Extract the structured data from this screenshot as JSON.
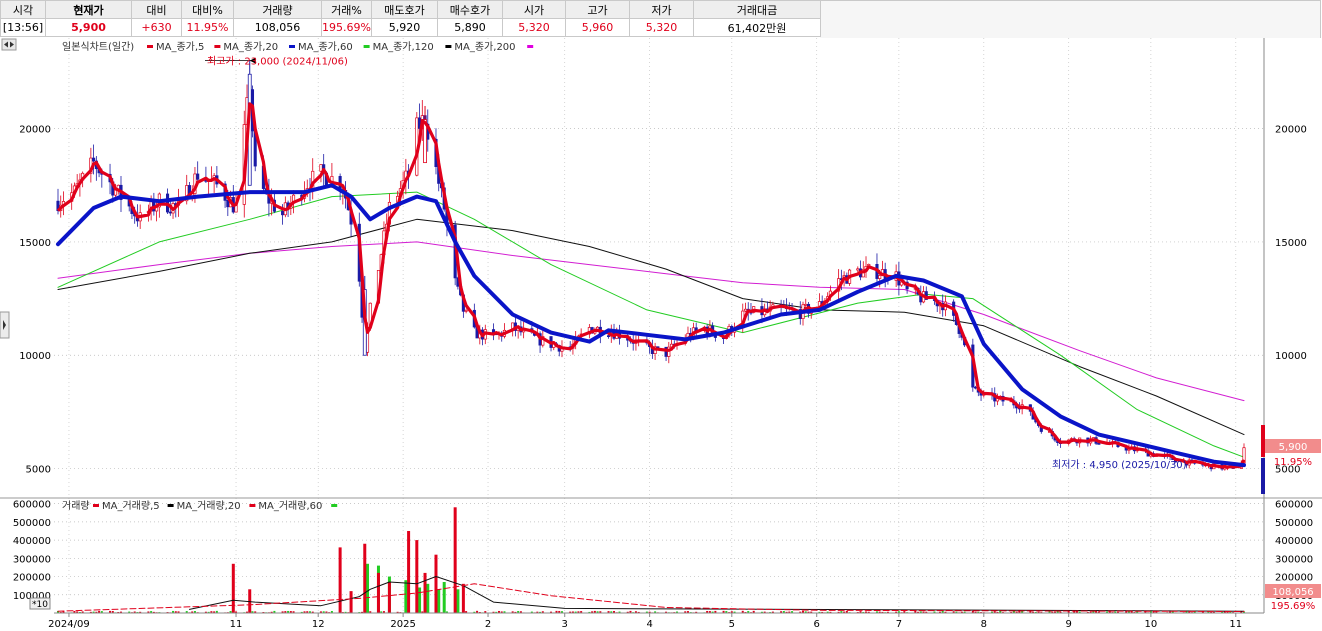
{
  "quote": {
    "headers": [
      "시각",
      "현재가",
      "대비",
      "대비%",
      "거래량",
      "거래%",
      "매도호가",
      "매수호가",
      "시가",
      "고가",
      "저가",
      "거래대금"
    ],
    "values": [
      "[13:56]",
      "5,900",
      "+630",
      "11.95%",
      "108,056",
      "195.69%",
      "5,920",
      "5,890",
      "5,320",
      "5,960",
      "5,320",
      "61,402만원"
    ]
  },
  "price_legend": {
    "title": "일본식차트(일간)",
    "items": [
      {
        "label": "MA_종가,5",
        "color": "#e0001b"
      },
      {
        "label": "MA_종가,20",
        "color": "#e0001b"
      },
      {
        "label": "MA_종가,60",
        "color": "#0a14c8"
      },
      {
        "label": "MA_종가,120",
        "color": "#22cc22"
      },
      {
        "label": "MA_종가,200",
        "color": "#000000"
      }
    ],
    "end_marker_color": "#e000e0"
  },
  "volume_legend": {
    "title": "거래량",
    "items": [
      {
        "label": "MA_거래량,5",
        "color": "#e0001b"
      },
      {
        "label": "MA_거래량,20",
        "color": "#000000"
      },
      {
        "label": "MA_거래량,60",
        "color": "#e0001b"
      }
    ],
    "end_marker_color": "#22cc22"
  },
  "annotations": {
    "high": "최고가 : 23,000 (2024/11/06)",
    "low": "최저가 : 4,950 (2025/10/30)"
  },
  "badges": {
    "price": "5,900",
    "price_pct": "11.95%",
    "volume": "108,056",
    "volume_pct": "195.69%"
  },
  "scale_button": "*10",
  "chart_data": {
    "type": "candlestick",
    "price_axis": {
      "ticks": [
        5000,
        10000,
        15000,
        20000
      ],
      "labels": [
        "5000",
        "10000",
        "15000",
        "20000"
      ],
      "range": [
        3700,
        24000
      ]
    },
    "volume_axis": {
      "ticks": [
        100000,
        200000,
        300000,
        400000,
        500000,
        600000
      ],
      "labels": [
        "100000",
        "200000",
        "300000",
        "400000",
        "500000",
        "600000"
      ],
      "range": [
        0,
        620000
      ]
    },
    "x_labels": [
      {
        "label": "2024/09",
        "date": "2024-09"
      },
      {
        "label": "11",
        "date": "2024-11"
      },
      {
        "label": "12",
        "date": "2024-12"
      },
      {
        "label": "2025",
        "date": "2025-01"
      },
      {
        "label": "2",
        "date": "2025-02"
      },
      {
        "label": "3",
        "date": "2025-03"
      },
      {
        "label": "4",
        "date": "2025-04"
      },
      {
        "label": "5",
        "date": "2025-05"
      },
      {
        "label": "6",
        "date": "2025-06"
      },
      {
        "label": "7",
        "date": "2025-07"
      },
      {
        "label": "8",
        "date": "2025-08"
      },
      {
        "label": "9",
        "date": "2025-09"
      },
      {
        "label": "10",
        "date": "2025-10"
      },
      {
        "label": "11",
        "date": "2025-11"
      }
    ],
    "price_path": [
      [
        "2024-08-28",
        16800
      ],
      [
        "2024-09-03",
        17200
      ],
      [
        "2024-09-10",
        18500
      ],
      [
        "2024-09-20",
        17000
      ],
      [
        "2024-09-27",
        16000
      ],
      [
        "2024-10-04",
        16800
      ],
      [
        "2024-10-11",
        16500
      ],
      [
        "2024-10-18",
        18000
      ],
      [
        "2024-10-25",
        17500
      ],
      [
        "2024-11-01",
        16500
      ],
      [
        "2024-11-06",
        22000
      ],
      [
        "2024-11-08",
        18000
      ],
      [
        "2024-11-12",
        17000
      ],
      [
        "2024-11-18",
        16200
      ],
      [
        "2024-11-26",
        17500
      ],
      [
        "2024-12-02",
        18000
      ],
      [
        "2024-12-06",
        17800
      ],
      [
        "2024-12-10",
        17500
      ],
      [
        "2024-12-13",
        16000
      ],
      [
        "2024-12-16",
        13500
      ],
      [
        "2024-12-18",
        10300
      ],
      [
        "2024-12-20",
        12000
      ],
      [
        "2024-12-24",
        14500
      ],
      [
        "2024-12-27",
        16500
      ],
      [
        "2025-01-03",
        18000
      ],
      [
        "2025-01-06",
        20000
      ],
      [
        "2025-01-09",
        20500
      ],
      [
        "2025-01-13",
        18200
      ],
      [
        "2025-01-16",
        16500
      ],
      [
        "2025-01-20",
        13200
      ],
      [
        "2025-01-23",
        12000
      ],
      [
        "2025-01-27",
        11000
      ],
      [
        "2025-02-03",
        10800
      ],
      [
        "2025-02-10",
        11200
      ],
      [
        "2025-02-17",
        10800
      ],
      [
        "2025-02-24",
        10500
      ],
      [
        "2025-03-03",
        10300
      ],
      [
        "2025-03-10",
        11200
      ],
      [
        "2025-03-17",
        11100
      ],
      [
        "2025-03-24",
        10800
      ],
      [
        "2025-03-31",
        10300
      ],
      [
        "2025-04-07",
        10100
      ],
      [
        "2025-04-14",
        10800
      ],
      [
        "2025-04-21",
        11200
      ],
      [
        "2025-04-28",
        10800
      ],
      [
        "2025-05-05",
        11800
      ],
      [
        "2025-05-12",
        11900
      ],
      [
        "2025-05-19",
        12000
      ],
      [
        "2025-05-26",
        11900
      ],
      [
        "2025-06-02",
        12200
      ],
      [
        "2025-06-09",
        13300
      ],
      [
        "2025-06-16",
        13700
      ],
      [
        "2025-06-23",
        13700
      ],
      [
        "2025-06-30",
        13500
      ],
      [
        "2025-07-04",
        12800
      ],
      [
        "2025-07-10",
        12500
      ],
      [
        "2025-07-17",
        12300
      ],
      [
        "2025-07-24",
        11000
      ],
      [
        "2025-07-28",
        8500
      ],
      [
        "2025-08-01",
        8200
      ],
      [
        "2025-08-08",
        8000
      ],
      [
        "2025-08-15",
        7800
      ],
      [
        "2025-08-22",
        6800
      ],
      [
        "2025-08-29",
        6200
      ],
      [
        "2025-09-05",
        6300
      ],
      [
        "2025-09-12",
        6200
      ],
      [
        "2025-09-19",
        6000
      ],
      [
        "2025-09-26",
        5800
      ],
      [
        "2025-10-03",
        5600
      ],
      [
        "2025-10-10",
        5400
      ],
      [
        "2025-10-17",
        5200
      ],
      [
        "2025-10-24",
        5100
      ],
      [
        "2025-10-30",
        5000
      ],
      [
        "2025-11-03",
        5300
      ],
      [
        "2025-11-04",
        5900
      ]
    ],
    "ma60": [
      [
        "2024-08-28",
        14900
      ],
      [
        "2024-09-10",
        16500
      ],
      [
        "2024-09-20",
        17000
      ],
      [
        "2024-10-04",
        16800
      ],
      [
        "2024-10-18",
        17000
      ],
      [
        "2024-11-06",
        17200
      ],
      [
        "2024-11-26",
        17200
      ],
      [
        "2024-12-06",
        17500
      ],
      [
        "2024-12-13",
        17000
      ],
      [
        "2024-12-20",
        16000
      ],
      [
        "2024-12-27",
        16500
      ],
      [
        "2025-01-06",
        17000
      ],
      [
        "2025-01-13",
        16800
      ],
      [
        "2025-01-20",
        15000
      ],
      [
        "2025-01-27",
        13500
      ],
      [
        "2025-02-10",
        11800
      ],
      [
        "2025-02-24",
        11000
      ],
      [
        "2025-03-10",
        10600
      ],
      [
        "2025-03-17",
        11100
      ],
      [
        "2025-03-31",
        10900
      ],
      [
        "2025-04-14",
        10700
      ],
      [
        "2025-04-28",
        11000
      ],
      [
        "2025-05-19",
        11800
      ],
      [
        "2025-06-02",
        12000
      ],
      [
        "2025-06-16",
        12800
      ],
      [
        "2025-06-30",
        13500
      ],
      [
        "2025-07-10",
        13300
      ],
      [
        "2025-07-24",
        12600
      ],
      [
        "2025-08-01",
        10500
      ],
      [
        "2025-08-15",
        8500
      ],
      [
        "2025-08-29",
        7300
      ],
      [
        "2025-09-12",
        6500
      ],
      [
        "2025-09-26",
        6100
      ],
      [
        "2025-10-10",
        5700
      ],
      [
        "2025-10-24",
        5300
      ],
      [
        "2025-11-04",
        5150
      ]
    ],
    "ma120": [
      [
        "2024-08-28",
        13000
      ],
      [
        "2024-10-04",
        15000
      ],
      [
        "2024-11-06",
        16000
      ],
      [
        "2024-12-06",
        17000
      ],
      [
        "2025-01-06",
        17200
      ],
      [
        "2025-01-27",
        16000
      ],
      [
        "2025-02-24",
        14000
      ],
      [
        "2025-03-31",
        12000
      ],
      [
        "2025-05-05",
        11000
      ],
      [
        "2025-06-16",
        12300
      ],
      [
        "2025-07-10",
        12700
      ],
      [
        "2025-07-28",
        12500
      ],
      [
        "2025-08-29",
        10000
      ],
      [
        "2025-09-26",
        7600
      ],
      [
        "2025-10-24",
        6000
      ],
      [
        "2025-11-04",
        5500
      ]
    ],
    "ma200": [
      [
        "2024-08-28",
        12900
      ],
      [
        "2024-10-04",
        13700
      ],
      [
        "2024-11-06",
        14500
      ],
      [
        "2024-12-06",
        15000
      ],
      [
        "2025-01-06",
        16000
      ],
      [
        "2025-02-10",
        15500
      ],
      [
        "2025-03-10",
        14800
      ],
      [
        "2025-04-07",
        13800
      ],
      [
        "2025-05-05",
        12500
      ],
      [
        "2025-06-02",
        12000
      ],
      [
        "2025-07-03",
        11900
      ],
      [
        "2025-08-01",
        11300
      ],
      [
        "2025-09-05",
        9500
      ],
      [
        "2025-10-03",
        8200
      ],
      [
        "2025-11-04",
        6500
      ]
    ],
    "ma_magenta": [
      [
        "2024-08-28",
        13400
      ],
      [
        "2024-10-04",
        14000
      ],
      [
        "2024-11-06",
        14500
      ],
      [
        "2024-12-06",
        14800
      ],
      [
        "2025-01-06",
        15000
      ],
      [
        "2025-02-10",
        14400
      ],
      [
        "2025-03-10",
        14000
      ],
      [
        "2025-04-07",
        13600
      ],
      [
        "2025-05-05",
        13200
      ],
      [
        "2025-06-02",
        13000
      ],
      [
        "2025-07-03",
        12900
      ],
      [
        "2025-08-01",
        11800
      ],
      [
        "2025-09-05",
        10200
      ],
      [
        "2025-10-03",
        9000
      ],
      [
        "2025-11-04",
        8000
      ]
    ],
    "volume_spikes": [
      [
        "2024-10-31",
        270000
      ],
      [
        "2024-11-06",
        130000
      ],
      [
        "2024-12-09",
        360000
      ],
      [
        "2024-12-13",
        120000
      ],
      [
        "2024-12-18",
        380000
      ],
      [
        "2024-12-23",
        220000
      ],
      [
        "2024-12-27",
        170000
      ],
      [
        "2025-01-03",
        450000
      ],
      [
        "2025-01-06",
        400000
      ],
      [
        "2025-01-09",
        220000
      ],
      [
        "2025-01-13",
        320000
      ],
      [
        "2025-01-20",
        580000
      ],
      [
        "2025-01-23",
        160000
      ]
    ],
    "volume_mid": [
      [
        "2024-12-19",
        270000
      ],
      [
        "2024-12-23",
        260000
      ],
      [
        "2024-12-27",
        200000
      ],
      [
        "2025-01-02",
        180000
      ],
      [
        "2025-01-07",
        140000
      ],
      [
        "2025-01-10",
        160000
      ],
      [
        "2025-01-14",
        130000
      ],
      [
        "2025-01-16",
        170000
      ],
      [
        "2025-01-21",
        130000
      ]
    ],
    "vol_ma20": [
      [
        "2024-10-15",
        20000
      ],
      [
        "2024-10-31",
        70000
      ],
      [
        "2024-11-08",
        60000
      ],
      [
        "2024-12-02",
        40000
      ],
      [
        "2024-12-16",
        90000
      ],
      [
        "2024-12-20",
        130000
      ],
      [
        "2024-12-27",
        170000
      ],
      [
        "2025-01-06",
        160000
      ],
      [
        "2025-01-13",
        200000
      ],
      [
        "2025-01-23",
        150000
      ],
      [
        "2025-02-03",
        60000
      ],
      [
        "2025-03-01",
        25000
      ],
      [
        "2025-11-04",
        10000
      ]
    ],
    "vol_ma60": [
      [
        "2024-08-28",
        10000
      ],
      [
        "2024-11-06",
        45000
      ],
      [
        "2024-12-16",
        80000
      ],
      [
        "2025-01-06",
        110000
      ],
      [
        "2025-01-27",
        160000
      ],
      [
        "2025-02-24",
        95000
      ],
      [
        "2025-04-07",
        30000
      ],
      [
        "2025-06-02",
        15000
      ],
      [
        "2025-11-04",
        8000
      ]
    ]
  }
}
